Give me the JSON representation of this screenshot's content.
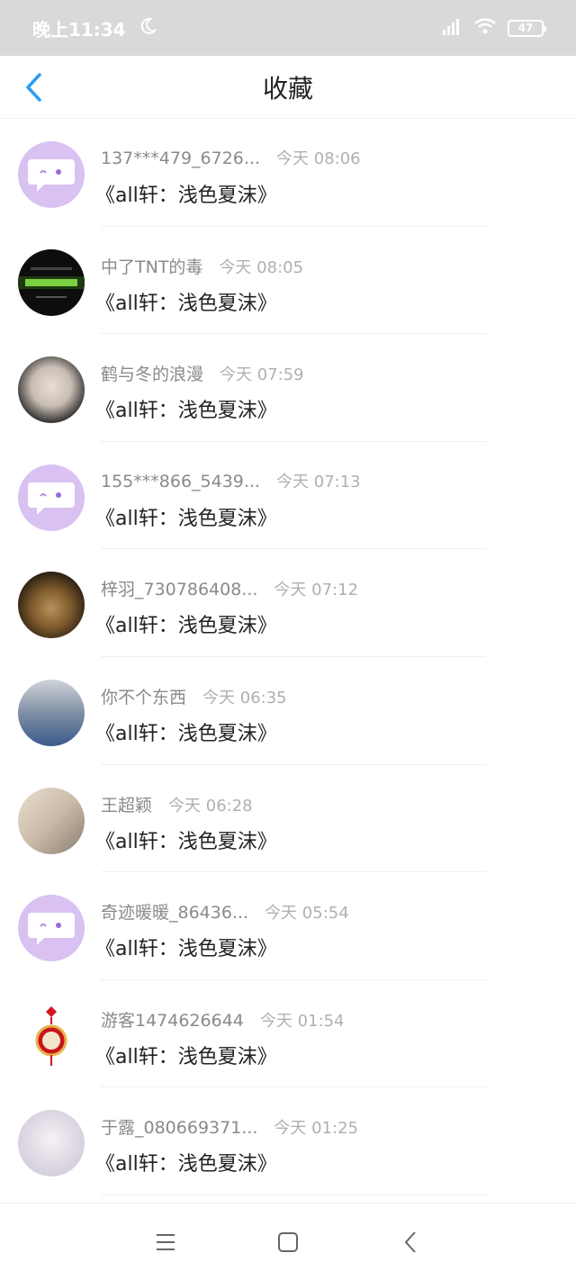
{
  "status_bar": {
    "time": "晚上11:34",
    "battery": "47"
  },
  "header": {
    "title": "收藏"
  },
  "colors": {
    "accent": "#2a9df4",
    "avatar_default": "#d9c2f2"
  },
  "items": [
    {
      "name": "137***479_6726...",
      "time": "今天 08:06",
      "title": "《all轩：浅色夏沫》",
      "avatar": "default-chat-icon"
    },
    {
      "name": "中了TNT的毒",
      "time": "今天 08:05",
      "title": "《all轩：浅色夏沫》",
      "avatar": "dark-text-avatar"
    },
    {
      "name": "鹤与冬的浪漫",
      "time": "今天 07:59",
      "title": "《all轩：浅色夏沫》",
      "avatar": "photo-avatar"
    },
    {
      "name": "155***866_5439...",
      "time": "今天 07:13",
      "title": "《all轩：浅色夏沫》",
      "avatar": "default-chat-icon"
    },
    {
      "name": "梓羽_730786408...",
      "time": "今天 07:12",
      "title": "《all轩：浅色夏沫》",
      "avatar": "photo-avatar"
    },
    {
      "name": "你不个东西",
      "time": "今天 06:35",
      "title": "《all轩：浅色夏沫》",
      "avatar": "photo-avatar"
    },
    {
      "name": "王超颖",
      "time": "今天 06:28",
      "title": "《all轩：浅色夏沫》",
      "avatar": "photo-avatar"
    },
    {
      "name": "奇迹暖暖_86436...",
      "time": "今天 05:54",
      "title": "《all轩：浅色夏沫》",
      "avatar": "default-chat-icon"
    },
    {
      "name": "游客1474626644",
      "time": "今天 01:54",
      "title": "《all轩：浅色夏沫》",
      "avatar": "fu-knot-avatar"
    },
    {
      "name": "于露_080669371...",
      "time": "今天 01:25",
      "title": "《all轩：浅色夏沫》",
      "avatar": "photo-avatar"
    }
  ],
  "bottom_nav": {
    "menu": "menu-icon",
    "home": "home-icon",
    "back": "back-icon"
  }
}
